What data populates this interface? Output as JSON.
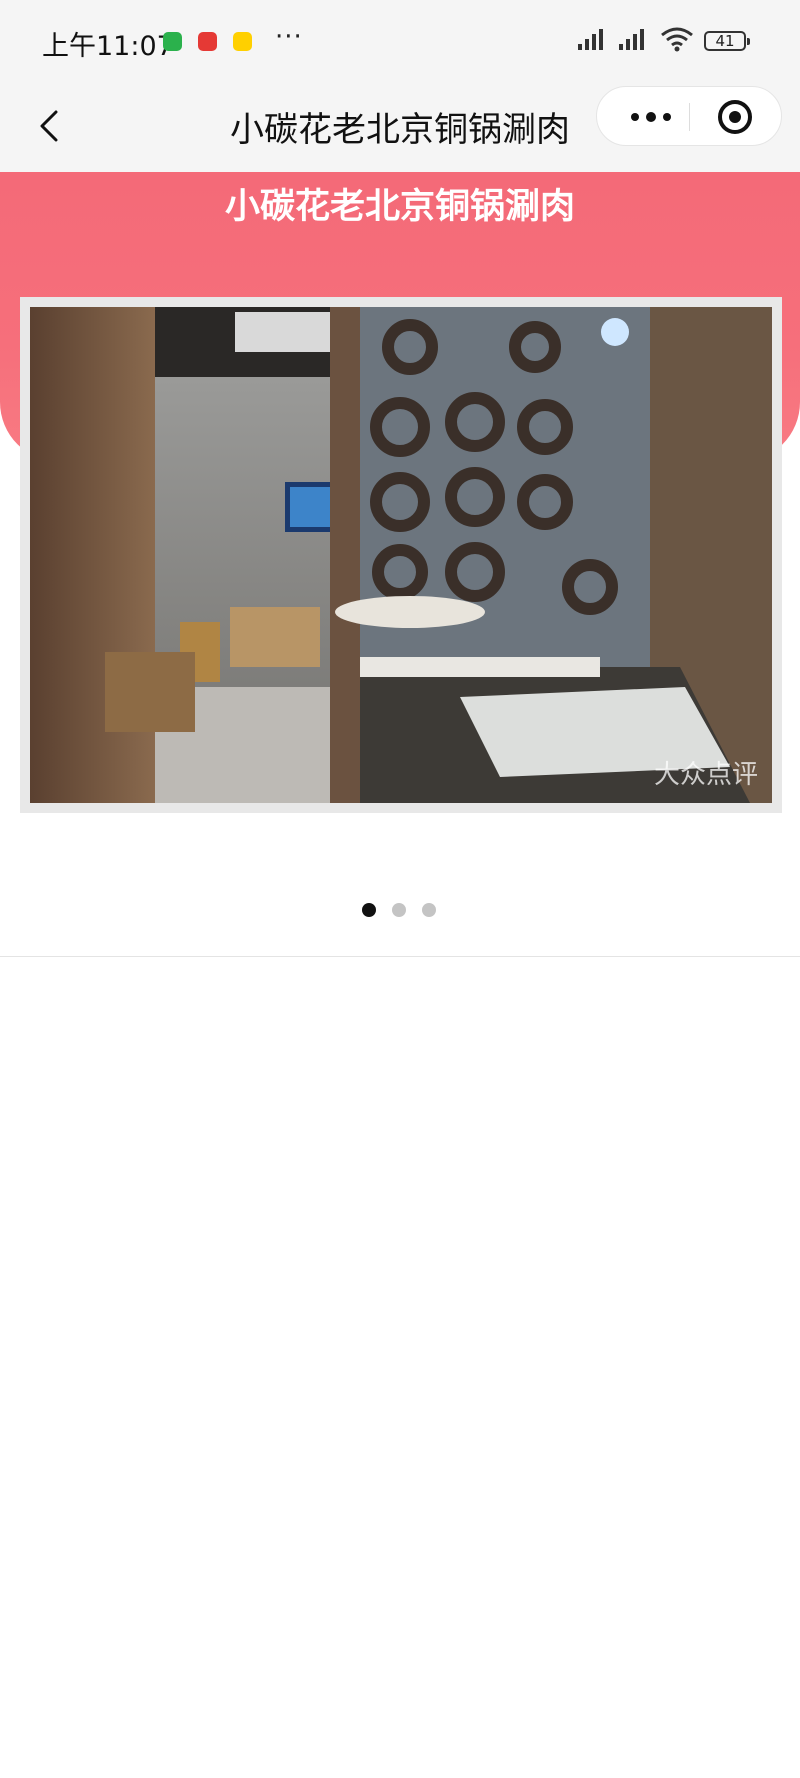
{
  "status_bar": {
    "time": "上午11:07",
    "more": "···",
    "battery": "41"
  },
  "nav": {
    "title": "小碳花老北京铜锅涮肉"
  },
  "header": {
    "title": "小碳花老北京铜锅涮肉",
    "photo_watermark": "大众点评"
  },
  "carousel": {
    "count": 3,
    "active": 0
  },
  "colors": {
    "pink": "#f46a78"
  }
}
